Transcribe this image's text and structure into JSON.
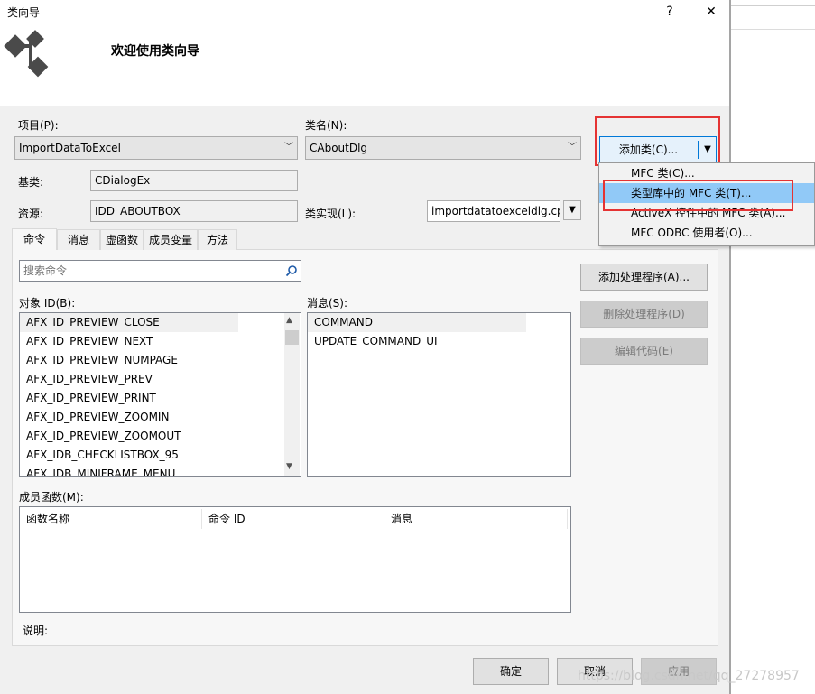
{
  "window": {
    "title": "类向导",
    "help_label": "?",
    "close_label": "✕",
    "header_text": "欢迎使用类向导"
  },
  "project": {
    "label": "项目(P):",
    "value": "ImportDataToExcel"
  },
  "classname": {
    "label": "类名(N):",
    "value": "CAboutDlg"
  },
  "add_class": {
    "label": "添加类(C)...",
    "arrow": "▼"
  },
  "base": {
    "label": "基类:",
    "value": "CDialogEx"
  },
  "resource": {
    "label": "资源:",
    "value": "IDD_ABOUTBOX"
  },
  "impl": {
    "label": "类实现(L):",
    "value": "importdatatoexceldlg.cp",
    "arrow": "▼"
  },
  "tabs": [
    {
      "label": "命令"
    },
    {
      "label": "消息"
    },
    {
      "label": "虚函数"
    },
    {
      "label": "成员变量"
    },
    {
      "label": "方法"
    }
  ],
  "search": {
    "placeholder": "搜索命令"
  },
  "object_ids": {
    "label": "对象 ID(B):",
    "items": [
      "AFX_ID_PREVIEW_CLOSE",
      "AFX_ID_PREVIEW_NEXT",
      "AFX_ID_PREVIEW_NUMPAGE",
      "AFX_ID_PREVIEW_PREV",
      "AFX_ID_PREVIEW_PRINT",
      "AFX_ID_PREVIEW_ZOOMIN",
      "AFX_ID_PREVIEW_ZOOMOUT",
      "AFX_IDB_CHECKLISTBOX_95",
      "AFX_IDB_MINIFRAME_MENU"
    ]
  },
  "messages": {
    "label": "消息(S):",
    "items": [
      "COMMAND",
      "UPDATE_COMMAND_UI"
    ]
  },
  "handler_buttons": {
    "add": "添加处理程序(A)...",
    "delete": "删除处理程序(D)",
    "edit": "编辑代码(E)"
  },
  "members": {
    "label": "成员函数(M):",
    "columns": [
      "函数名称",
      "命令 ID",
      "消息"
    ]
  },
  "description_label": "说明:",
  "footer": {
    "ok": "确定",
    "cancel": "取消",
    "apply": "应用"
  },
  "dropdown_menu": [
    "MFC 类(C)...",
    "类型库中的 MFC 类(T)...",
    "ActiveX 控件中的 MFC 类(A)...",
    "MFC ODBC 使用者(O)..."
  ],
  "watermark": "https://blog.csdn.net/qq_27278957"
}
